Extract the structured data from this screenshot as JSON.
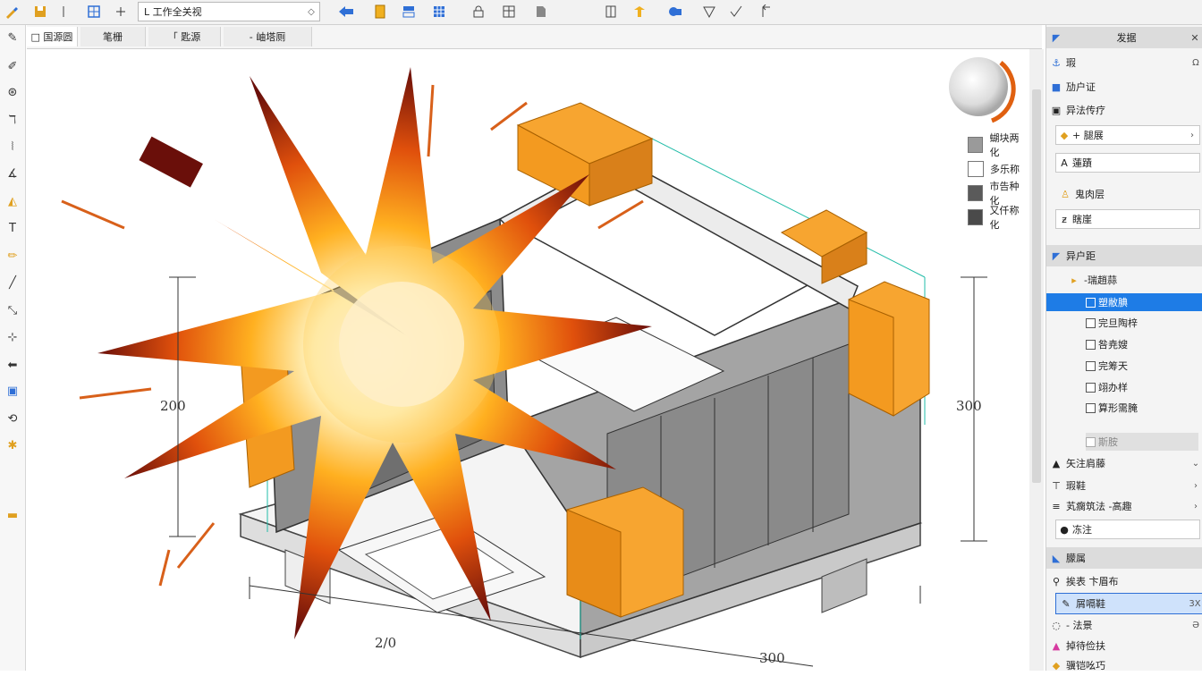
{
  "toolbar": {
    "combo_value": "L 工作全关视",
    "icons": [
      "pencil-icon",
      "save-icon",
      "cursor-icon",
      "grid-icon",
      "plus-icon",
      "back-arrow-icon",
      "yellow-box-icon",
      "stack-icon",
      "blue-grid-icon",
      "lock-icon",
      "table-icon",
      "page-icon",
      "frame-icon",
      "arrow-tool-icon",
      "blue-shape-icon",
      "shield-icon",
      "check-icon",
      "return-icon"
    ]
  },
  "tabs": [
    {
      "label": "□ 国源圆"
    },
    {
      "label": "笔栅"
    },
    {
      "label": "「 匙源"
    },
    {
      "label": "‐ 岫塔厕"
    }
  ],
  "canvas": {
    "dimension_left": "200",
    "dimension_right": "300",
    "dimension_bottom": "300",
    "dimension_bottom_left": "2/0",
    "legend": [
      {
        "label": "蝴块两化",
        "color": "#9a9a9a"
      },
      {
        "label": "多乐称",
        "color": "#ffffff"
      },
      {
        "label": "市告种化",
        "color": "#5a5a5a"
      },
      {
        "label": "又仟称化",
        "color": "#4a4a4a"
      }
    ]
  },
  "panel": {
    "header1": {
      "label": "发据"
    },
    "rows1": [
      {
        "label": "瑕",
        "right": "Ω"
      },
      {
        "label": "劢户证"
      },
      {
        "label": "异法传疗"
      }
    ],
    "boxes1": [
      {
        "label": "+ 腿展"
      },
      {
        "label": "蓮蹟"
      },
      {
        "label": "鬼肉层",
        "plain": true
      },
      {
        "label": "瞎崖"
      }
    ],
    "header2": {
      "label": "异户距"
    },
    "tree_root": "-瑞趙蒜",
    "checklist": [
      {
        "label": "塑敝腆",
        "selected": true
      },
      {
        "label": "完旦陶梓"
      },
      {
        "label": "咎尭嫂"
      },
      {
        "label": "完筹天"
      },
      {
        "label": "翊办样"
      },
      {
        "label": "算形需腌"
      },
      {
        "label": "斯胺"
      }
    ],
    "rows2": [
      {
        "label": "矢注肩藤"
      },
      {
        "label": "瑕鞋"
      },
      {
        "label": "芄瘸筑法 ‐高趣"
      },
      {
        "label": "冻注"
      }
    ],
    "header3": {
      "label": "朦属"
    },
    "rows3": [
      {
        "label": "挨表 卞眉布"
      },
      {
        "label": "屑嗝鞋",
        "right": "3X"
      },
      {
        "label": "- 法景",
        "right": "Ə"
      },
      {
        "label": "掉待俭扶"
      },
      {
        "label": "骥铠吆巧"
      }
    ]
  }
}
